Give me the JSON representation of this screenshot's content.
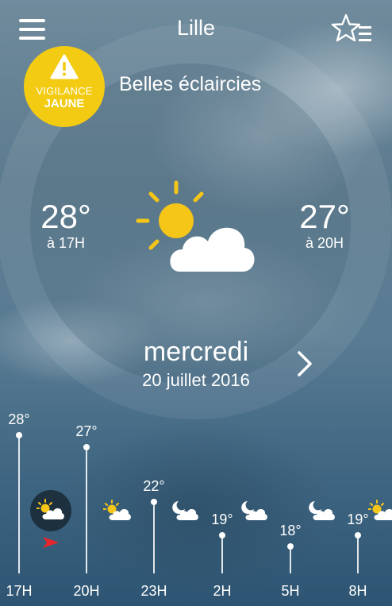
{
  "header": {
    "city": "Lille",
    "menu_icon": "hamburger-menu-icon",
    "favorite_icon": "star-list-icon"
  },
  "vigilance": {
    "line1": "VIGILANCE",
    "line2": "JAUNE",
    "color": "#f2cb12",
    "icon": "warning-triangle-icon"
  },
  "weather": {
    "condition": "Belles éclaircies",
    "icon": "sun-cloud-icon",
    "left_temp": {
      "value": "28°",
      "time": "à 17H"
    },
    "right_temp": {
      "value": "27°",
      "time": "à 20H"
    }
  },
  "day": {
    "name": "mercredi",
    "date": "20 juillet 2016",
    "next_icon": "chevron-right-icon"
  },
  "forecast": [
    {
      "hour": "17H",
      "temp": "28°",
      "icon": "sun-cloud-icon",
      "current": true
    },
    {
      "hour": "20H",
      "temp": "27°",
      "icon": "sun-cloud-icon"
    },
    {
      "hour": "23H",
      "temp": "22°",
      "icon": "moon-cloud-icon"
    },
    {
      "hour": "2H",
      "temp": "19°",
      "icon": "moon-cloud-icon"
    },
    {
      "hour": "5H",
      "temp": "18°",
      "icon": "moon-cloud-icon"
    },
    {
      "hour": "8H",
      "temp": "19°",
      "icon": "sun-cloud-icon"
    }
  ],
  "current_marker_icon": "red-arrow-icon",
  "colors": {
    "accent_yellow": "#f2cb12",
    "sun": "#f5c518",
    "marker_red": "#e8262a"
  }
}
